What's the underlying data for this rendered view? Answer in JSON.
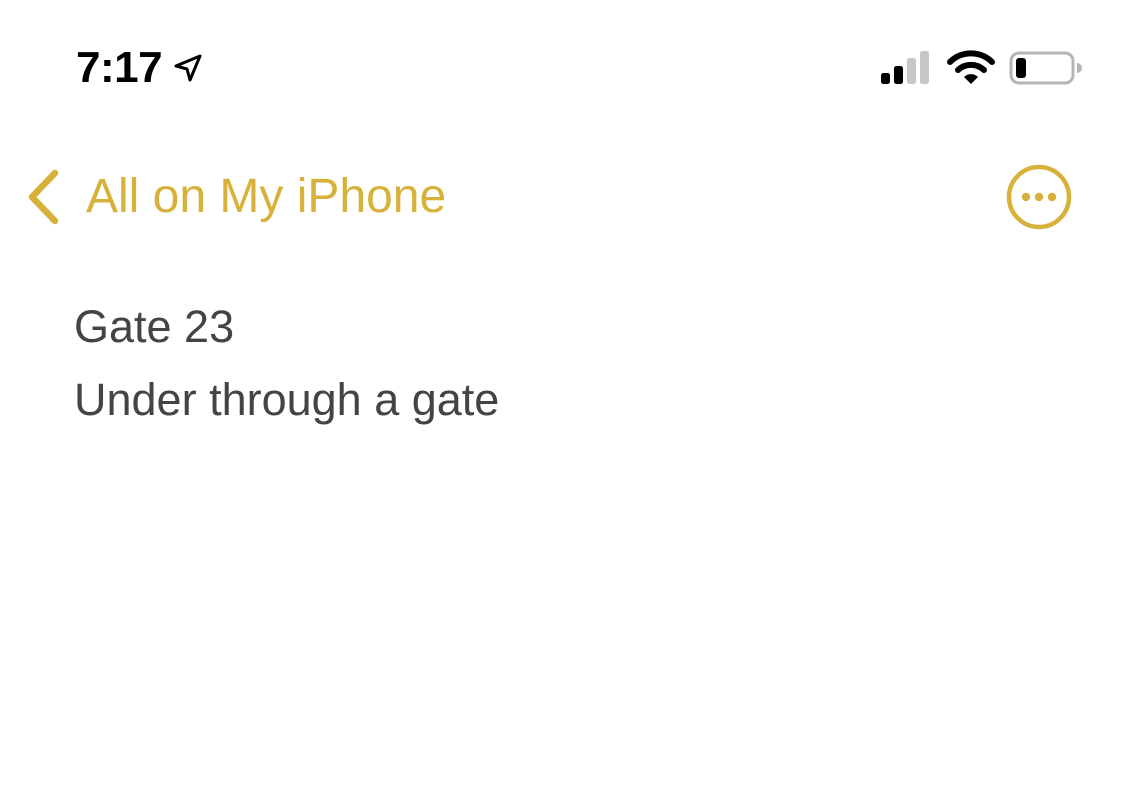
{
  "status_bar": {
    "time": "7:17",
    "icons": [
      "location-arrow-icon",
      "cellular-signal-icon",
      "wifi-icon",
      "battery-icon"
    ]
  },
  "nav": {
    "back_label": "All on My iPhone",
    "back_icon": "chevron-left-icon",
    "more_icon": "ellipsis-circle-icon"
  },
  "note": {
    "lines": [
      "Gate 23",
      "Under through a gate"
    ]
  },
  "colors": {
    "accent": "#D8B13A",
    "note_text": "#444444",
    "status_text": "#000000",
    "background": "#ffffff"
  }
}
